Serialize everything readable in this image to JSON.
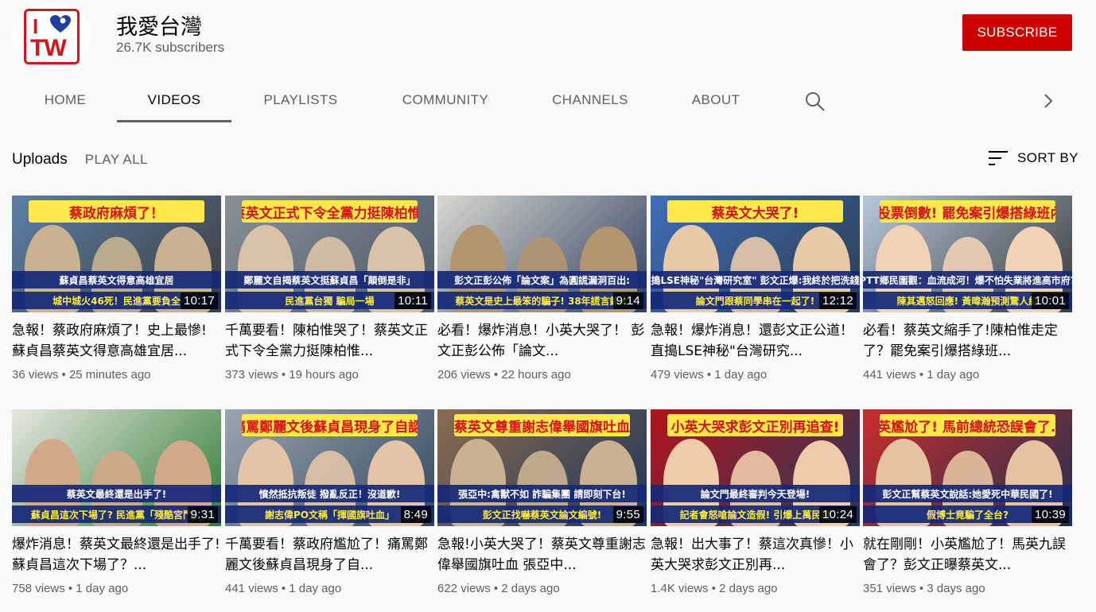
{
  "channel": {
    "name": "我愛台灣",
    "subscribers": "26.7K subscribers",
    "logo_i": "I",
    "logo_tw": "TW",
    "subscribe_label": "SUBSCRIBE"
  },
  "tabs": [
    {
      "label": "HOME"
    },
    {
      "label": "VIDEOS"
    },
    {
      "label": "PLAYLISTS"
    },
    {
      "label": "COMMUNITY"
    },
    {
      "label": "CHANNELS"
    },
    {
      "label": "ABOUT"
    }
  ],
  "section": {
    "title": "Uploads",
    "play_all": "PLAY ALL",
    "sort_label": "SORT BY"
  },
  "colors": {
    "subscribe_bg": "#cc0000",
    "banner_text": "#d4131b",
    "caption_bg": "#142878"
  },
  "videos": [
    {
      "banner": "蔡政府麻煩了！",
      "cap1": "蘇貞昌蔡英文得意高雄宜居",
      "cap2": "城中城火46死！民進黨要負全",
      "duration": "10:17",
      "title": "急報！蔡政府麻煩了！史上最慘! 蘇貞昌蔡英文得意高雄宜居...",
      "views": "36 views",
      "age": "25 minutes ago"
    },
    {
      "banner": "蔡英文正式下令全黨力挺陳柏惟!",
      "cap1": "鄭麗文自揭蔡英文挺蘇貞昌「顛倒是非」",
      "cap2": "民進黨台獨 騙局一場",
      "duration": "10:11",
      "title": "千萬要看！陳柏惟哭了！蔡英文正式下令全黨力挺陳柏惟...",
      "views": "373 views",
      "age": "19 hours ago"
    },
    {
      "banner": "",
      "cap1": "彭文正彭公佈「論文案」為圓謊漏洞百出:",
      "cap2": "蔡英文是史上最笨的騙子! 38年謊言錄大",
      "duration": "9:14",
      "title": "必看！爆炸消息！小英大哭了！ 彭文正彭公佈「論文...",
      "views": "206 views",
      "age": "22 hours ago"
    },
    {
      "banner": "蔡英文大哭了!",
      "cap1": "直搗LSE神秘\"台灣研究室\" 彭文正爆:我終於把洗錢案",
      "cap2": "論文門跟蔡同學串在一起了!",
      "duration": "12:12",
      "title": "急報！爆炸消息！還彭文正公道！直搗LSE神秘\"台灣研究...",
      "views": "479 views",
      "age": "1 day ago"
    },
    {
      "banner": "罷免投票倒數! 罷免案引爆搭綠班內戰?",
      "cap1": "PTT鄉民圍觀：血流成河！爆不怕失業將進高市府?",
      "cap2": "陳其邁怒回應! 黃暐瀚預測驚人結",
      "duration": "10:01",
      "title": "必看！蔡英文縮手了!陳柏惟走定了？罷免案引爆搭綠班...",
      "views": "441 views",
      "age": "1 day ago"
    },
    {
      "banner": "",
      "cap1": "蔡英文最終還是出手了!",
      "cap2": "蘇貞昌這次下場了? 民進黨「殘酷宮鬥」",
      "duration": "9:31",
      "title": "爆炸消息！蔡英文最終還是出手了! 蘇貞昌這次下場了？...",
      "views": "758 views",
      "age": "1 day ago"
    },
    {
      "banner": "痛罵鄭麗文後蘇貞昌現身了自認:",
      "cap1": "憤然抵抗叛徒 撥亂反正！沒道歉!",
      "cap2": "謝志偉PO文稱「揮國旗吐血」",
      "duration": "8:49",
      "title": "千萬要看！蔡政府尷尬了！痛罵鄭麗文後蘇貞昌現身了自...",
      "views": "441 views",
      "age": "1 day ago"
    },
    {
      "banner": "蔡英文尊重謝志偉舉國旗吐血",
      "cap1": "張亞中:禽獸不如 詐騙集團 請即刻下台!",
      "cap2": "彭文正找嚇蔡英文論文編號!",
      "duration": "9:55",
      "title": "急報!小英大哭了！蔡英文尊重謝志偉舉國旗吐血 張亞中...",
      "views": "622 views",
      "age": "2 days ago"
    },
    {
      "banner": "小英大哭求彭文正別再追查!",
      "cap1": "論文門最終審判今天登場!",
      "cap2": "記者會怒嗆論文造假! 引爆上萬民眾",
      "duration": "10:24",
      "title": "急報！出大事了！蔡這次真慘！小英大哭求彭文正別再...",
      "views": "1.4K views",
      "age": "2 days ago"
    },
    {
      "banner": "小英尷尬了! 馬前總統恐誤會了....",
      "cap1": "彭文正幫蔡英文說話:她愛死中華民國了!",
      "cap2": "假博士竟騙了全台?",
      "duration": "10:39",
      "title": "就在剛剛！小英尷尬了！馬英九誤會了？彭文正曝蔡英文...",
      "views": "351 views",
      "age": "3 days ago"
    }
  ]
}
